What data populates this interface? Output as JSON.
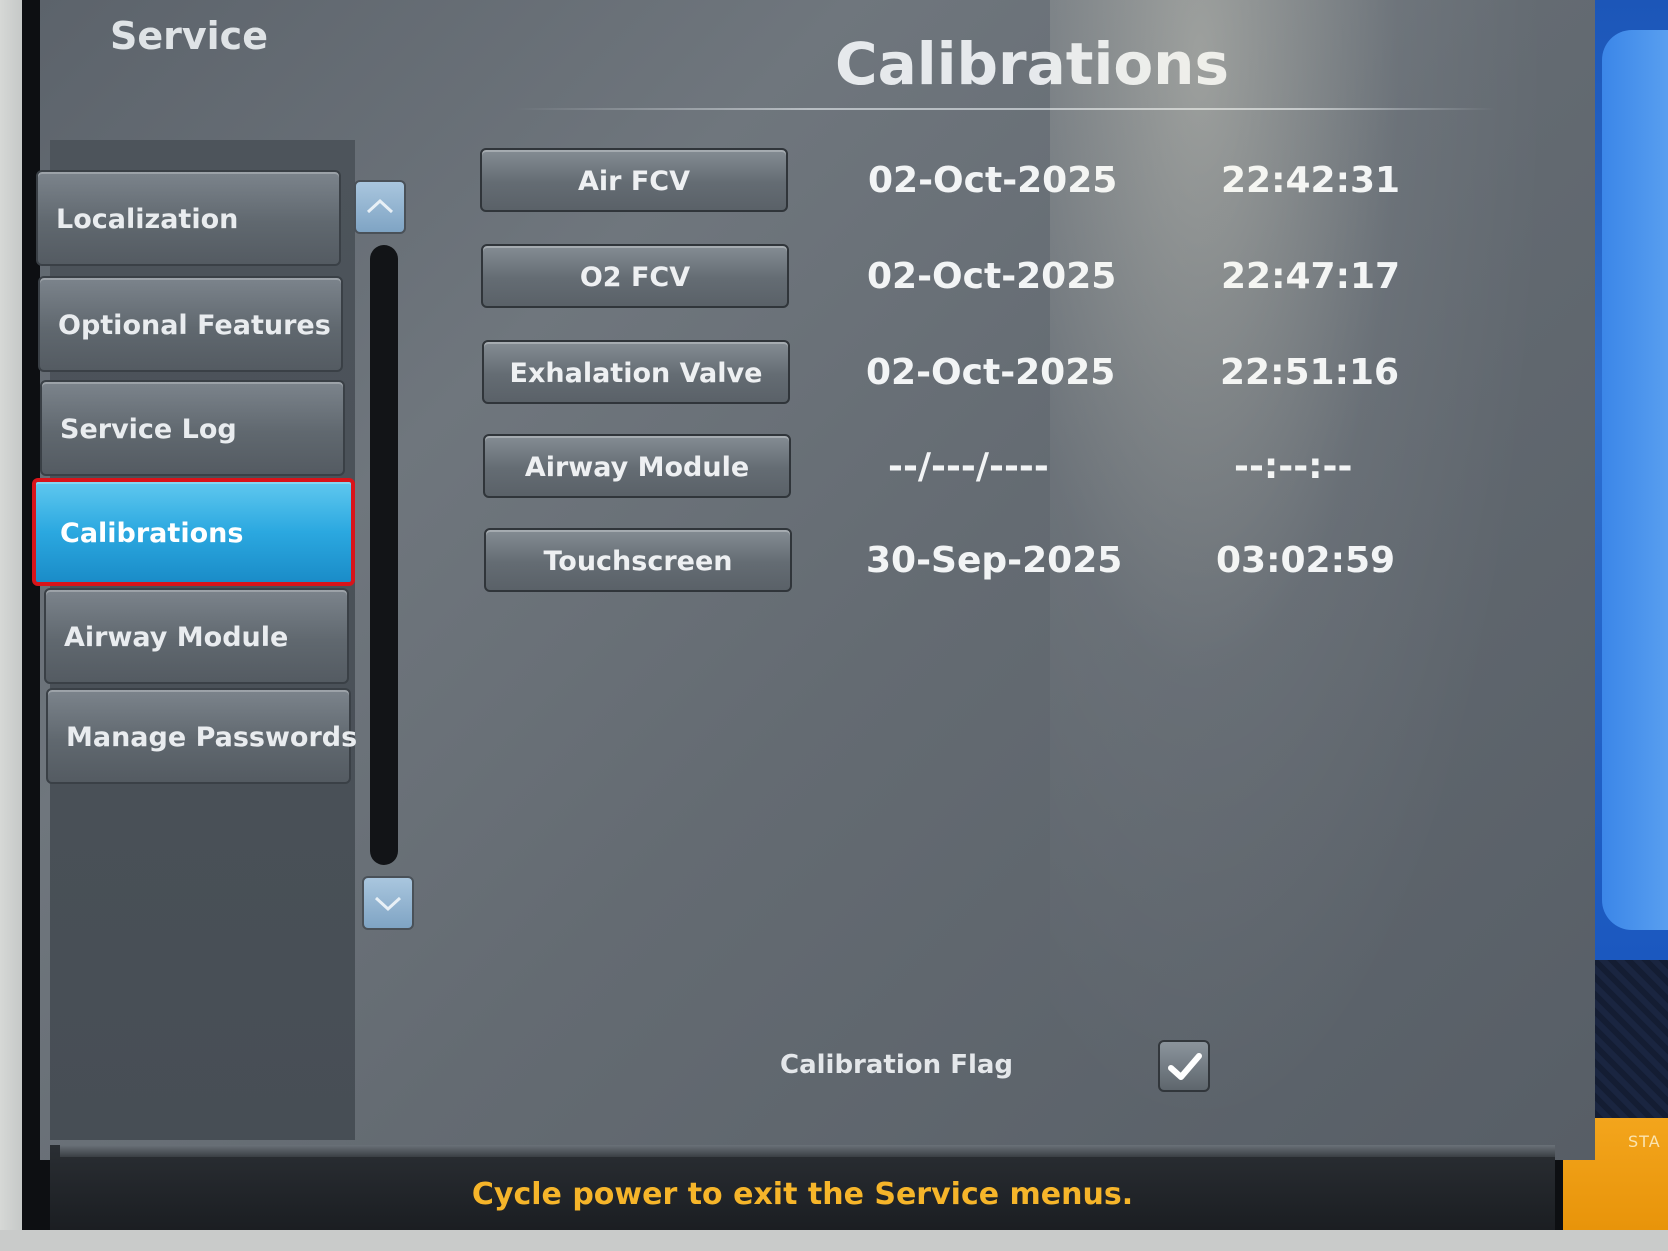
{
  "header": {
    "section_title": "Service",
    "page_title": "Calibrations"
  },
  "sidebar": {
    "items": [
      {
        "label": "Localization",
        "active": false
      },
      {
        "label": "Optional Features",
        "active": false
      },
      {
        "label": "Service Log",
        "active": false
      },
      {
        "label": "Calibrations",
        "active": true
      },
      {
        "label": "Airway Module",
        "active": false
      },
      {
        "label": "Manage Passwords",
        "active": false
      }
    ],
    "scroll_up_icon": "chevron-up-icon",
    "scroll_down_icon": "chevron-down-icon"
  },
  "calibrations": [
    {
      "label": "Air FCV",
      "date": "02-Oct-2025",
      "time": "22:42:31"
    },
    {
      "label": "O2 FCV",
      "date": "02-Oct-2025",
      "time": "22:47:17"
    },
    {
      "label": "Exhalation Valve",
      "date": "02-Oct-2025",
      "time": "22:51:16"
    },
    {
      "label": "Airway Module",
      "date": "--/---/----",
      "time": "--:--:--"
    },
    {
      "label": "Touchscreen",
      "date": "30-Sep-2025",
      "time": "03:02:59"
    }
  ],
  "calibration_flag": {
    "label": "Calibration Flag",
    "checked": true
  },
  "status": {
    "message": "Cycle power to exit the Service menus."
  },
  "start_button": {
    "label": "STA"
  },
  "colors": {
    "active_item": "#2ba8e0",
    "active_outline": "#d8141a",
    "status_text": "#f6b52a",
    "start_button": "#e8940a"
  }
}
